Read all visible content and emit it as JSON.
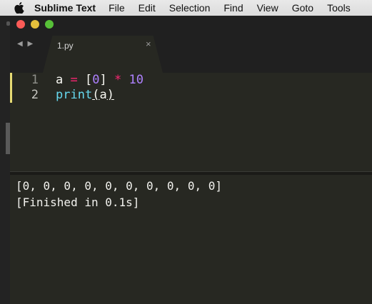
{
  "menubar": {
    "app_name": "Sublime Text",
    "items": [
      "File",
      "Edit",
      "Selection",
      "Find",
      "View",
      "Goto",
      "Tools"
    ]
  },
  "window": {
    "tab_nav": "◀ ▶",
    "tab": {
      "title": "1.py",
      "close": "×"
    }
  },
  "editor": {
    "lines": [
      {
        "number": "1",
        "tokens": {
          "var": "a",
          "eq": "=",
          "lb": "[",
          "zero": "0",
          "rb": "]",
          "mul": "*",
          "ten": "10"
        }
      },
      {
        "number": "2",
        "tokens": {
          "fn": "print",
          "open": "(",
          "arg": "a",
          "close": ")"
        }
      }
    ]
  },
  "output": {
    "lines": [
      "[0, 0, 0, 0, 0, 0, 0, 0, 0, 0]",
      "[Finished in 0.1s]"
    ]
  },
  "colors": {
    "keyword_pink": "#f92672",
    "number_purple": "#ae81ff",
    "function_cyan": "#66d9ef",
    "editor_bg": "#272822"
  }
}
